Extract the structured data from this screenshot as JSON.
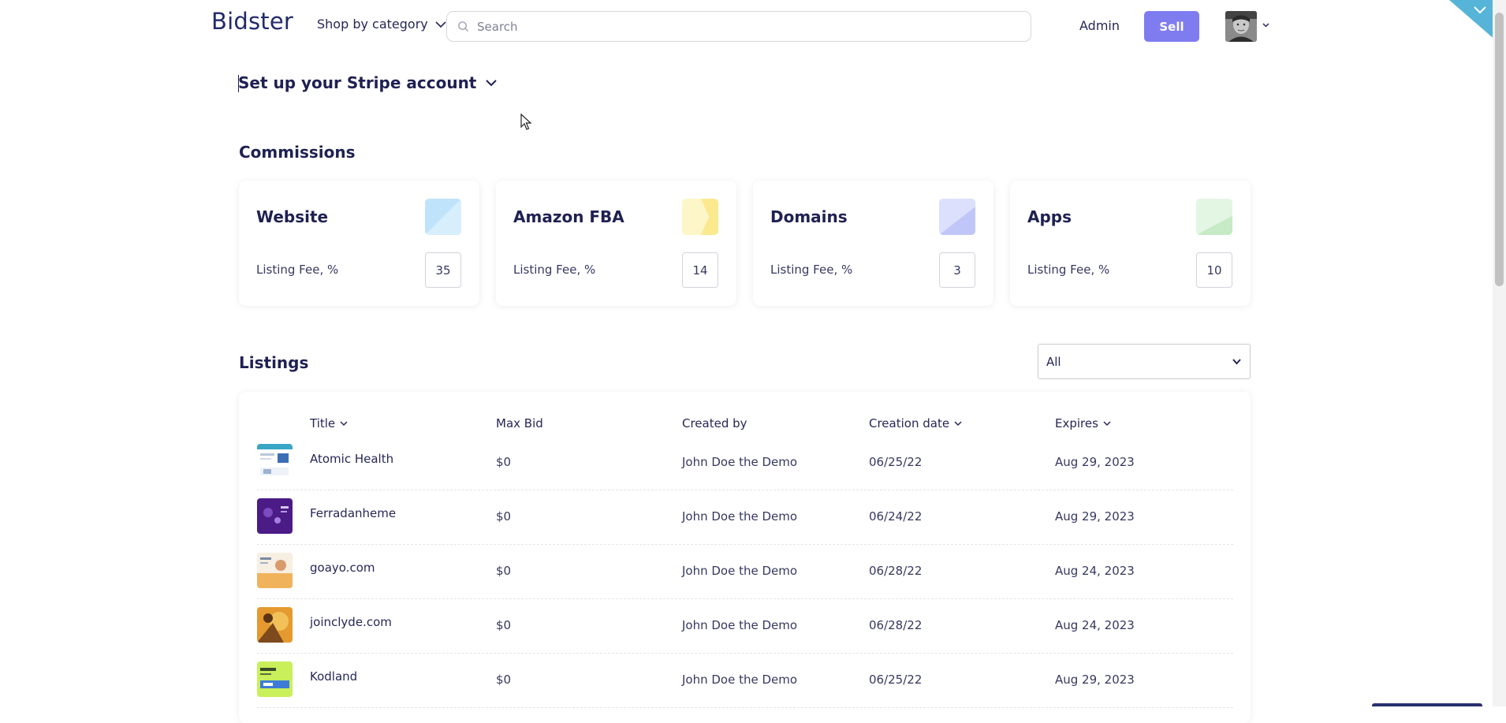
{
  "header": {
    "logo": "Bidster",
    "shop_by_category": "Shop by category",
    "search_placeholder": "Search",
    "admin": "Admin",
    "sell": "Sell"
  },
  "stripe": {
    "label": "Set up your Stripe account"
  },
  "commissions": {
    "title": "Commissions",
    "cards": [
      {
        "title": "Website",
        "label": "Listing Fee, %",
        "value": "35",
        "color": "#bfe3fb"
      },
      {
        "title": "Amazon FBA",
        "label": "Listing Fee, %",
        "value": "14",
        "color": "#fbf1b8"
      },
      {
        "title": "Domains",
        "label": "Listing Fee, %",
        "value": "3",
        "color": "#cfd3fb"
      },
      {
        "title": "Apps",
        "label": "Listing Fee, %",
        "value": "10",
        "color": "#d7f1d7"
      }
    ]
  },
  "listings": {
    "title": "Listings",
    "filter_value": "All",
    "columns": {
      "title": "Title",
      "max_bid": "Max Bid",
      "created_by": "Created by",
      "creation_date": "Creation date",
      "expires": "Expires"
    },
    "rows": [
      {
        "title": "Atomic Health",
        "max_bid": "$0",
        "created_by": "John Doe the Demo",
        "creation_date": "06/25/22",
        "expires": "Aug 29, 2023"
      },
      {
        "title": "Ferradanheme",
        "max_bid": "$0",
        "created_by": "John Doe the Demo",
        "creation_date": "06/24/22",
        "expires": "Aug 29, 2023"
      },
      {
        "title": "goayo.com",
        "max_bid": "$0",
        "created_by": "John Doe the Demo",
        "creation_date": "06/28/22",
        "expires": "Aug 24, 2023"
      },
      {
        "title": "joinclyde.com",
        "max_bid": "$0",
        "created_by": "John Doe the Demo",
        "creation_date": "06/28/22",
        "expires": "Aug 24, 2023"
      },
      {
        "title": "Kodland",
        "max_bid": "$0",
        "created_by": "John Doe the Demo",
        "creation_date": "06/25/22",
        "expires": "Aug 29, 2023"
      }
    ]
  }
}
